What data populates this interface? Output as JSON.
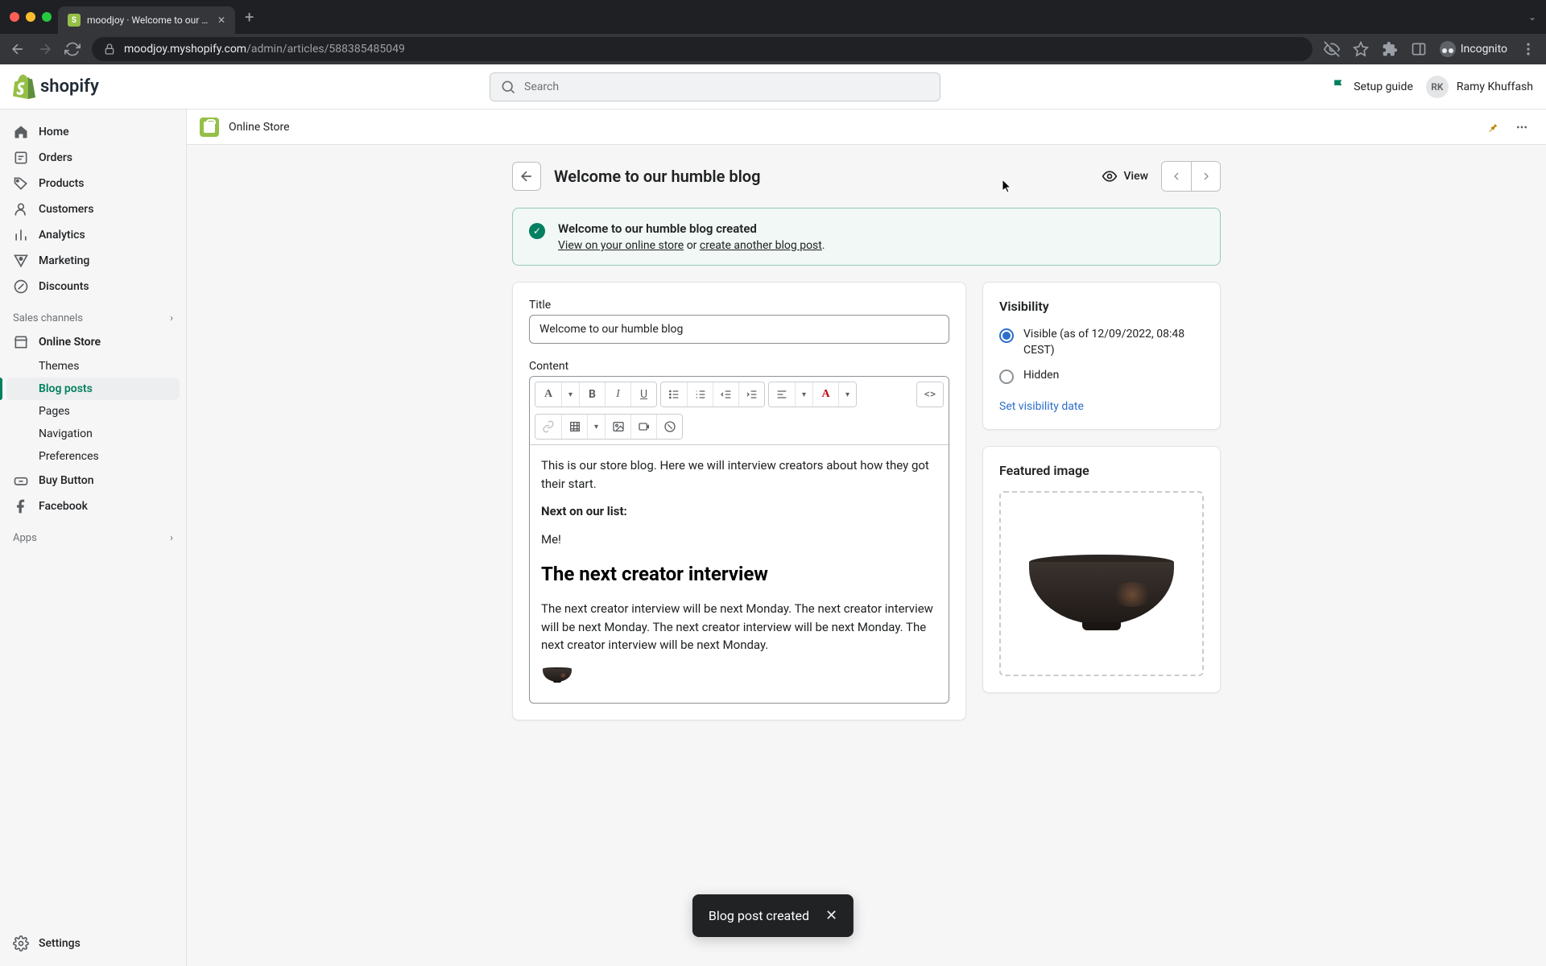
{
  "browser": {
    "tab_title": "moodjoy · Welcome to our hum",
    "url_host": "moodjoy.myshopify.com",
    "url_path": "/admin/articles/588385485049",
    "incognito_label": "Incognito"
  },
  "header": {
    "brand": "shopify",
    "search_placeholder": "Search",
    "setup_guide": "Setup guide",
    "user_initials": "RK",
    "user_name": "Ramy Khuffash"
  },
  "sidebar": {
    "items": [
      {
        "label": "Home"
      },
      {
        "label": "Orders"
      },
      {
        "label": "Products"
      },
      {
        "label": "Customers"
      },
      {
        "label": "Analytics"
      },
      {
        "label": "Marketing"
      },
      {
        "label": "Discounts"
      }
    ],
    "sales_channels_label": "Sales channels",
    "channels": [
      {
        "label": "Online Store",
        "children": [
          {
            "label": "Themes"
          },
          {
            "label": "Blog posts",
            "active": true
          },
          {
            "label": "Pages"
          },
          {
            "label": "Navigation"
          },
          {
            "label": "Preferences"
          }
        ]
      },
      {
        "label": "Buy Button"
      },
      {
        "label": "Facebook"
      }
    ],
    "apps_label": "Apps",
    "settings_label": "Settings"
  },
  "content_top": {
    "breadcrumb": "Online Store"
  },
  "page": {
    "title": "Welcome to our humble blog",
    "view_label": "View"
  },
  "banner": {
    "title": "Welcome to our humble blog created",
    "link1": "View on your online store",
    "or": " or ",
    "link2": "create another blog post",
    "period": "."
  },
  "form": {
    "title_label": "Title",
    "title_value": "Welcome to our humble blog",
    "content_label": "Content",
    "rte_paragraph1": "This is our store blog. Here we will interview creators about how they got their start.",
    "rte_strong": "Next on our list:",
    "rte_me": "Me!",
    "rte_h2": "The next creator interview",
    "rte_paragraph2": "The next creator interview will be next Monday.  The next creator interview will be next Monday. The next creator interview will be next Monday. The next creator interview will be next Monday."
  },
  "visibility": {
    "heading": "Visibility",
    "visible_label": "Visible (as of 12/09/2022, 08:48 CEST)",
    "hidden_label": "Hidden",
    "set_date_label": "Set visibility date"
  },
  "featured": {
    "heading": "Featured image"
  },
  "toast": {
    "message": "Blog post created"
  }
}
